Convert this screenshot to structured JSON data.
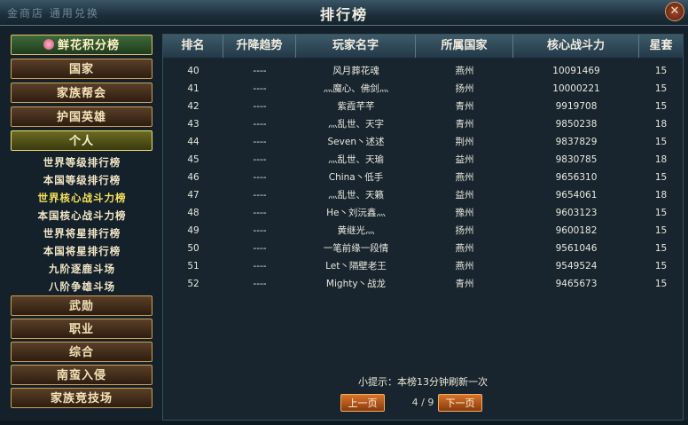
{
  "window": {
    "title": "排行榜",
    "background_tabs": "金商店    通用兑换",
    "close_label": "✕"
  },
  "sidebar": {
    "top": [
      {
        "label": "鲜花积分榜",
        "icon": "flower-icon",
        "state": "active"
      },
      {
        "label": "国家"
      },
      {
        "label": "家族帮会"
      },
      {
        "label": "护国英雄"
      },
      {
        "label": "个人",
        "state": "selected"
      }
    ],
    "sub": [
      {
        "label": "世界等级排行榜"
      },
      {
        "label": "本国等级排行榜"
      },
      {
        "label": "世界核心战斗力榜",
        "current": true
      },
      {
        "label": "本国核心战斗力榜"
      },
      {
        "label": "世界将星排行榜"
      },
      {
        "label": "本国将星排行榜"
      },
      {
        "label": "九阶逐鹿斗场"
      },
      {
        "label": "八阶争雄斗场"
      }
    ],
    "bottom": [
      {
        "label": "武勋"
      },
      {
        "label": "职业"
      },
      {
        "label": "综合"
      },
      {
        "label": "南蛮入侵"
      },
      {
        "label": "家族竞技场"
      }
    ]
  },
  "table": {
    "headers": [
      "排名",
      "升降趋势",
      "玩家名字",
      "所属国家",
      "核心战斗力",
      "星套"
    ],
    "rows": [
      [
        "40",
        "----",
        "风月葬花魂",
        "燕州",
        "10091469",
        "15"
      ],
      [
        "41",
        "----",
        "灬魔心、佛剑灬",
        "扬州",
        "10000221",
        "15"
      ],
      [
        "42",
        "----",
        "紫霞芊芊",
        "青州",
        "9919708",
        "15"
      ],
      [
        "43",
        "----",
        "灬乱世、天字",
        "青州",
        "9850238",
        "18"
      ],
      [
        "44",
        "----",
        "Seven丶述述",
        "荆州",
        "9837829",
        "15"
      ],
      [
        "45",
        "----",
        "灬乱世、天瑜",
        "益州",
        "9830785",
        "18"
      ],
      [
        "46",
        "----",
        "China丶低手",
        "燕州",
        "9656310",
        "15"
      ],
      [
        "47",
        "----",
        "灬乱世、天籁",
        "益州",
        "9654061",
        "18"
      ],
      [
        "48",
        "----",
        "He丶刘沅鑫灬",
        "豫州",
        "9603123",
        "15"
      ],
      [
        "49",
        "----",
        "黄继光灬",
        "扬州",
        "9600182",
        "15"
      ],
      [
        "50",
        "----",
        "一笔前缘一段情",
        "燕州",
        "9561046",
        "15"
      ],
      [
        "51",
        "----",
        "Let丶隔壁老王",
        "燕州",
        "9549524",
        "15"
      ],
      [
        "52",
        "----",
        "Mighty丶战龙",
        "青州",
        "9465673",
        "15"
      ]
    ]
  },
  "footer": {
    "tip": "小提示：本榜13分钟刷新一次",
    "prev_label": "上一页",
    "next_label": "下一页",
    "page_info": "4 / 9"
  }
}
